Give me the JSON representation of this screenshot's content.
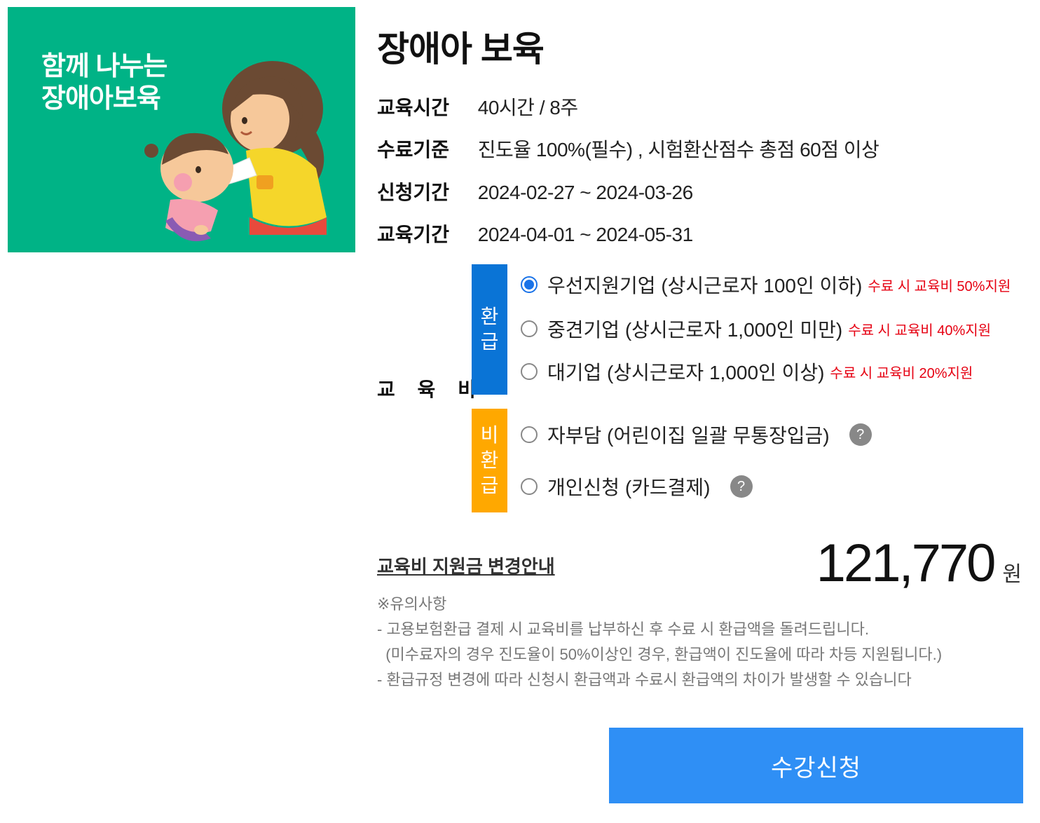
{
  "course": {
    "banner_text": [
      "함께 나누는",
      "장애아보육"
    ],
    "title": "장애아 보육",
    "info": [
      {
        "label": "교육시간",
        "value": "40시간 / 8주"
      },
      {
        "label": "수료기준",
        "value": "진도율 100%(필수) , 시험환산점수 총점 60점 이상"
      },
      {
        "label": "신청기간",
        "value": "2024-02-27 ~ 2024-03-26"
      },
      {
        "label": "교육기간",
        "value": "2024-04-01 ~ 2024-05-31"
      }
    ]
  },
  "fee": {
    "label": "교 육 비",
    "refund_tag": [
      "환",
      "급"
    ],
    "nonrefund_tag": [
      "비",
      "환",
      "급"
    ],
    "refund_options": [
      {
        "label": "우선지원기업 (상시근로자 100인 이하)",
        "note": "수료 시 교육비 50%지원",
        "checked": true
      },
      {
        "label": "중견기업 (상시근로자 1,000인 미만)",
        "note": "수료 시 교육비 40%지원",
        "checked": false
      },
      {
        "label": "대기업 (상시근로자 1,000인 이상)",
        "note": "수료 시 교육비 20%지원",
        "checked": false
      }
    ],
    "nonrefund_options": [
      {
        "label": "자부담 (어린이집 일괄 무통장입금)",
        "help": "?",
        "checked": false
      },
      {
        "label": "개인신청 (카드결제)",
        "help": "?",
        "checked": false
      }
    ]
  },
  "notice_link": "교육비 지원금 변경안내",
  "price": {
    "amount": "121,770",
    "unit": "원"
  },
  "notes": [
    "※유의사항",
    "- 고용보험환급 결제 시 교육비를 납부하신 후 수료 시 환급액을 돌려드립니다.",
    "  (미수료자의 경우 진도율이 50%이상인 경우, 환급액이 진도율에 따라 차등 지원됩니다.)",
    "- 환급규정 변경에 따라 신청시 환급액과 수료시 환급액의 차이가 발생할 수 있습니다"
  ],
  "apply_button": "수강신청",
  "colors": {
    "banner_bg": "#00b386",
    "refund_tag": "#0a74d6",
    "nonrefund_tag": "#ffa800",
    "note_red": "#e60012",
    "apply_button": "#2f8ff5",
    "radio_selected": "#1a73e8"
  }
}
